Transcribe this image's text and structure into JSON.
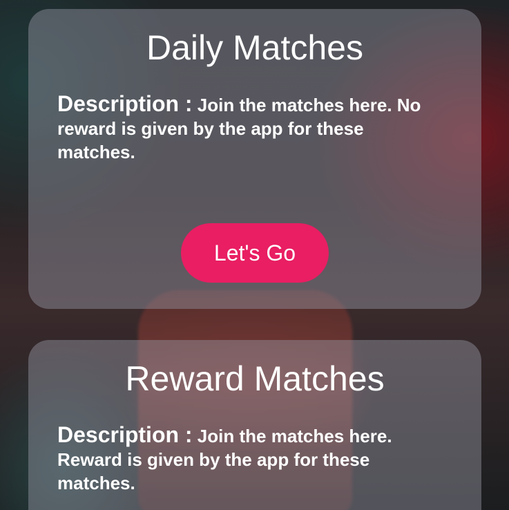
{
  "colors": {
    "accent": "#e91e63",
    "card_overlay": "rgba(150,150,165,0.45)",
    "text": "#ffffff"
  },
  "cards": [
    {
      "title": "Daily Matches",
      "description_label": "Description :",
      "description_text": " Join the matches here. No reward is given by the app for these matches.",
      "button_label": "Let's Go"
    },
    {
      "title": "Reward Matches",
      "description_label": "Description :",
      "description_text": " Join the matches here. Reward is given by the app for these matches."
    }
  ]
}
